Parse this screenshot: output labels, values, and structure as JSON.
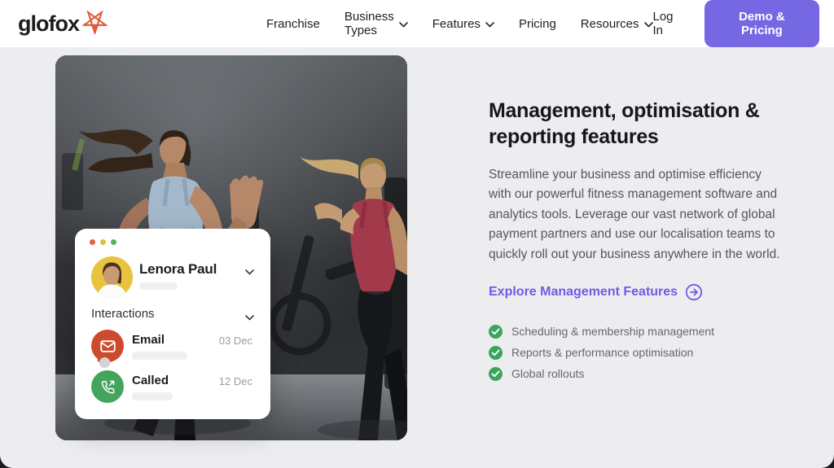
{
  "header": {
    "logo_text": "glofox",
    "nav": [
      {
        "label": "Franchise",
        "has_dropdown": false
      },
      {
        "label": "Business Types",
        "has_dropdown": true
      },
      {
        "label": "Features",
        "has_dropdown": true
      },
      {
        "label": "Pricing",
        "has_dropdown": false
      },
      {
        "label": "Resources",
        "has_dropdown": true
      }
    ],
    "login_label": "Log In",
    "cta_label": "Demo & Pricing"
  },
  "hero": {
    "heading": "Management, optimisation & reporting features",
    "paragraph": "Streamline your business and optimise efficiency with our powerful fitness management software and analytics tools. Leverage our vast network of global payment partners and use our localisation teams to quickly roll out your business anywhere in the world.",
    "link_label": "Explore Management Features",
    "features": [
      "Scheduling & membership management",
      "Reports & performance optimisation",
      "Global rollouts"
    ]
  },
  "card": {
    "contact_name": "Lenora Paul",
    "section_label": "Interactions",
    "interactions": [
      {
        "type": "Email",
        "date": "03 Dec",
        "icon": "email-icon"
      },
      {
        "type": "Called",
        "date": "12 Dec",
        "icon": "phone-outgoing-icon"
      }
    ]
  },
  "colors": {
    "brand_orange": "#e2593b",
    "accent_purple_link": "#6c5ce7",
    "accent_purple_button": "#7668e2",
    "check_green": "#3aa55d",
    "email_red": "#cd4a2d",
    "called_green": "#44a35c",
    "avatar_yellow": "#e9c33f",
    "section_gray": "#ededef",
    "heading_dark": "#17171b",
    "body_gray": "#55555f"
  }
}
